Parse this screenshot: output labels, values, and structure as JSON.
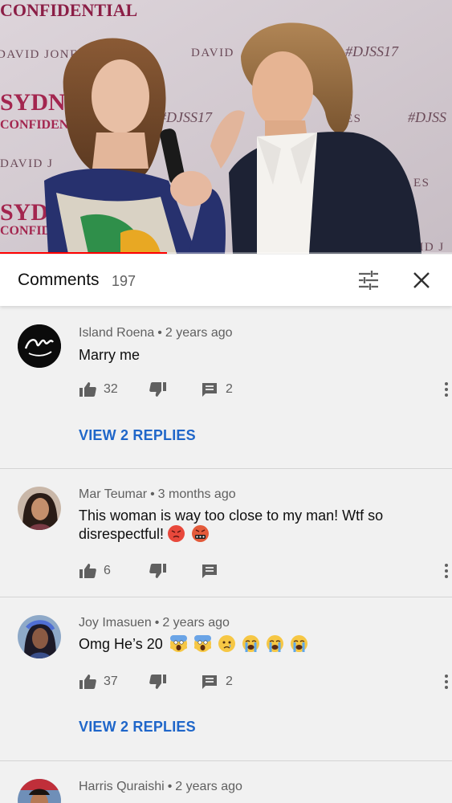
{
  "video": {
    "progress_fraction": 0.37,
    "backdrop_texts": [
      "CONFIDENTIAL",
      "DAVID JONES",
      "DAVID",
      "#DJSS17",
      "SYDNEY",
      "CONFIDENTIAL",
      "#DJSS17",
      "ES",
      "#DJSS",
      "DAVID J",
      "ES",
      "SYDN",
      "CONFID",
      "VID J"
    ]
  },
  "header": {
    "title": "Comments",
    "count": "197",
    "sort_icon": "tune-icon",
    "close_icon": "close-icon"
  },
  "comments": [
    {
      "author": "Island Roena",
      "time": "2 years ago",
      "text": "Marry me",
      "emojis": [],
      "likes": "32",
      "replies": "2",
      "view_replies": "VIEW 2 REPLIES"
    },
    {
      "author": "Mar Teumar",
      "time": "3 months ago",
      "text": "This woman is way too close to my man! Wtf so disrespectful!",
      "emojis": [
        "pouting-face",
        "face-with-symbols"
      ],
      "likes": "6",
      "replies": "",
      "view_replies": ""
    },
    {
      "author": "Joy Imasuen",
      "time": "2 years ago",
      "text": "Omg He’s 20",
      "emojis": [
        "screaming-face",
        "screaming-face",
        "crying-face",
        "loudly-crying-face",
        "loudly-crying-face",
        "loudly-crying-face"
      ],
      "likes": "37",
      "replies": "2",
      "view_replies": "VIEW 2 REPLIES"
    },
    {
      "author": "Harris Quraishi",
      "time": "2 years ago",
      "text": "",
      "emojis": [],
      "likes": "",
      "replies": "",
      "view_replies": ""
    }
  ],
  "colors": {
    "accent_link": "#1f66c9",
    "progress": "#ff0000",
    "background": "#f1f1f1",
    "header_bg": "#ffffff"
  }
}
